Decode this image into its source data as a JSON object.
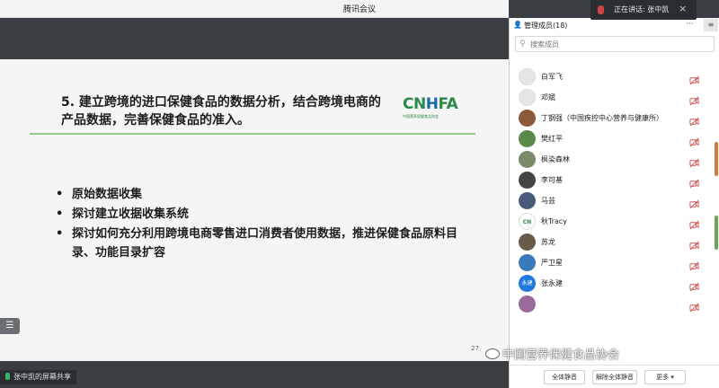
{
  "window": {
    "title": "腾讯会议"
  },
  "speaking_banner": {
    "text": "正在讲话: 张中凯",
    "close": "×"
  },
  "slide": {
    "heading": "5. 建立跨境的进口保健食品的数据分析，结合跨境电商的产品数据，完善保健食品的准入。",
    "logo_text": "CNHFA",
    "logo_sub": "中国营养保健食品协会",
    "bullets": [
      "原始数据收集",
      "探讨建立收据收集系统",
      "探讨如何充分利用跨境电商零售进口消费者使用数据，推进保健食品原料目录、功能目录扩容"
    ],
    "page_number": "27"
  },
  "share_label": "张中凯的屏幕共享",
  "panel": {
    "title": "管理成员(18)",
    "more": "···",
    "menu": "≡",
    "search_placeholder": "搜索成员",
    "members": [
      {
        "name": "白军飞",
        "avatar_text": "",
        "color": "#e6e6e6"
      },
      {
        "name": "邓斌",
        "avatar_text": "",
        "color": "#e6e6e6"
      },
      {
        "name": "丁钢强（中国疾控中心营养与健康所）",
        "avatar_text": "",
        "color": "#8a5a3a"
      },
      {
        "name": "樊红平",
        "avatar_text": "",
        "color": "#5a8a4a"
      },
      {
        "name": "枫染森林",
        "avatar_text": "",
        "color": "#7a8a6a"
      },
      {
        "name": "李可基",
        "avatar_text": "",
        "color": "#444444"
      },
      {
        "name": "马芸",
        "avatar_text": "",
        "color": "#4a5a7a"
      },
      {
        "name": "秋Tracy",
        "avatar_text": "CN",
        "color": "#ffffff"
      },
      {
        "name": "苏龙",
        "avatar_text": "",
        "color": "#6a5a4a"
      },
      {
        "name": "严卫星",
        "avatar_text": "",
        "color": "#3a7aba"
      },
      {
        "name": "张永建",
        "avatar_text": "永建",
        "color": "#1f7ae0"
      },
      {
        "name": "",
        "avatar_text": "",
        "color": "#9a6a9a"
      }
    ],
    "buttons": {
      "mute_all": "全体静音",
      "unmute_all": "解除全体静音",
      "more": "更多 ▾"
    }
  },
  "watermark": "中国营养保健食品协会",
  "colors": {
    "accent_green": "#9cc98a",
    "logo_green": "#2a8a4a",
    "logo_blue": "#1a6ab0",
    "mic_off_red": "#d05050"
  }
}
